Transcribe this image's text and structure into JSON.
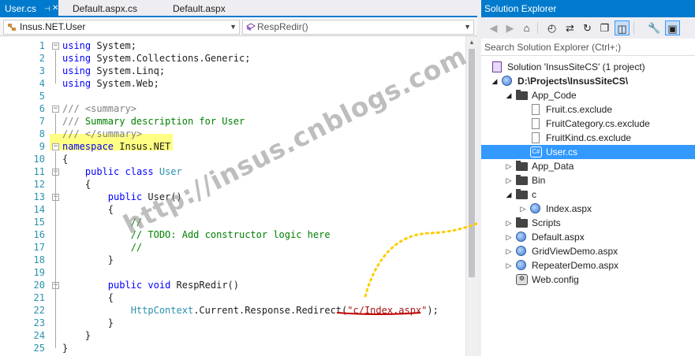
{
  "editor": {
    "tabs": [
      {
        "label": "User.cs",
        "active": true
      },
      {
        "label": "Default.aspx.cs",
        "active": false
      },
      {
        "label": "Default.aspx",
        "active": false
      }
    ],
    "pin_icon": "pin-icon",
    "close_icon": "close-icon",
    "nav_class": "Insus.NET.User",
    "nav_member": "RespRedir()",
    "lines": [
      {
        "n": "1",
        "segs": [
          {
            "c": "kw",
            "t": "using"
          },
          {
            "c": "",
            "t": " System;"
          }
        ],
        "fold": "minus"
      },
      {
        "n": "2",
        "segs": [
          {
            "c": "kw",
            "t": "using"
          },
          {
            "c": "",
            "t": " System.Collections.Generic;"
          }
        ]
      },
      {
        "n": "3",
        "segs": [
          {
            "c": "kw",
            "t": "using"
          },
          {
            "c": "",
            "t": " System.Linq;"
          }
        ]
      },
      {
        "n": "4",
        "segs": [
          {
            "c": "kw",
            "t": "using"
          },
          {
            "c": "",
            "t": " System.Web;"
          }
        ]
      },
      {
        "n": "5",
        "segs": []
      },
      {
        "n": "6",
        "segs": [
          {
            "c": "dc",
            "t": "/// "
          },
          {
            "c": "dc",
            "t": "<summary>"
          }
        ],
        "fold": "minus"
      },
      {
        "n": "7",
        "segs": [
          {
            "c": "dc",
            "t": "/// "
          },
          {
            "c": "cm",
            "t": "Summary description for User"
          }
        ]
      },
      {
        "n": "8",
        "segs": [
          {
            "c": "dc",
            "t": "/// </summary>"
          }
        ]
      },
      {
        "n": "9",
        "segs": [
          {
            "c": "kw",
            "t": "namespace"
          },
          {
            "c": "",
            "t": " Insus.NET"
          }
        ],
        "fold": "minus"
      },
      {
        "n": "10",
        "segs": [
          {
            "c": "",
            "t": "{"
          }
        ]
      },
      {
        "n": "11",
        "segs": [
          {
            "c": "",
            "t": "    "
          },
          {
            "c": "kw",
            "t": "public"
          },
          {
            "c": "",
            "t": " "
          },
          {
            "c": "kw",
            "t": "class"
          },
          {
            "c": "",
            "t": " "
          },
          {
            "c": "ty",
            "t": "User"
          }
        ],
        "fold": "minus"
      },
      {
        "n": "12",
        "segs": [
          {
            "c": "",
            "t": "    {"
          }
        ]
      },
      {
        "n": "13",
        "segs": [
          {
            "c": "",
            "t": "        "
          },
          {
            "c": "kw",
            "t": "public"
          },
          {
            "c": "",
            "t": " User()"
          }
        ],
        "fold": "minus"
      },
      {
        "n": "14",
        "segs": [
          {
            "c": "",
            "t": "        {"
          }
        ]
      },
      {
        "n": "15",
        "segs": [
          {
            "c": "",
            "t": "            "
          },
          {
            "c": "cm",
            "t": "//"
          }
        ]
      },
      {
        "n": "16",
        "segs": [
          {
            "c": "",
            "t": "            "
          },
          {
            "c": "cm",
            "t": "// TODO: Add constructor logic here"
          }
        ]
      },
      {
        "n": "17",
        "segs": [
          {
            "c": "",
            "t": "            "
          },
          {
            "c": "cm",
            "t": "//"
          }
        ]
      },
      {
        "n": "18",
        "segs": [
          {
            "c": "",
            "t": "        }"
          }
        ]
      },
      {
        "n": "19",
        "segs": []
      },
      {
        "n": "20",
        "segs": [
          {
            "c": "",
            "t": "        "
          },
          {
            "c": "kw",
            "t": "public"
          },
          {
            "c": "",
            "t": " "
          },
          {
            "c": "kw",
            "t": "void"
          },
          {
            "c": "",
            "t": " RespRedir()"
          }
        ],
        "fold": "minus"
      },
      {
        "n": "21",
        "segs": [
          {
            "c": "",
            "t": "        {"
          }
        ]
      },
      {
        "n": "22",
        "segs": [
          {
            "c": "",
            "t": "            "
          },
          {
            "c": "ty",
            "t": "HttpContext"
          },
          {
            "c": "",
            "t": ".Current.Response.Redirect("
          },
          {
            "c": "st",
            "t": "\"c/Index.aspx\""
          },
          {
            "c": "",
            "t": ");"
          }
        ]
      },
      {
        "n": "23",
        "segs": [
          {
            "c": "",
            "t": "        }"
          }
        ]
      },
      {
        "n": "24",
        "segs": [
          {
            "c": "",
            "t": "    }"
          }
        ]
      },
      {
        "n": "25",
        "segs": [
          {
            "c": "",
            "t": "}"
          }
        ]
      }
    ],
    "watermark": "http://insus.cnblogs.com",
    "colors": {
      "highlight": "#ffff00",
      "underline": "#c00000",
      "arrow": "#ffcc00",
      "accent": "#007acc"
    }
  },
  "solution_explorer": {
    "title": "Solution Explorer",
    "search_placeholder": "Search Solution Explorer (Ctrl+;)",
    "toolbar_icons": [
      "back-icon",
      "forward-icon",
      "home-icon",
      "history-icon",
      "sync-icon",
      "refresh-icon",
      "collapse-all-icon",
      "show-all-files-icon",
      "properties-icon",
      "preview-icon"
    ],
    "tree": [
      {
        "label": "Solution 'InsusSiteCS' (1 project)",
        "depth": 0,
        "icon": "solution",
        "exp": ""
      },
      {
        "label": "D:\\Projects\\InsusSiteCS\\",
        "depth": 0,
        "icon": "globe",
        "exp": "open",
        "bold": true
      },
      {
        "label": "App_Code",
        "depth": 1,
        "icon": "folder",
        "exp": "open"
      },
      {
        "label": "Fruit.cs.exclude",
        "depth": 2,
        "icon": "file",
        "exp": ""
      },
      {
        "label": "FruitCategory.cs.exclude",
        "depth": 2,
        "icon": "file",
        "exp": ""
      },
      {
        "label": "FruitKind.cs.exclude",
        "depth": 2,
        "icon": "file",
        "exp": ""
      },
      {
        "label": "User.cs",
        "depth": 2,
        "icon": "cs",
        "exp": "",
        "selected": true
      },
      {
        "label": "App_Data",
        "depth": 1,
        "icon": "folder",
        "exp": "closed"
      },
      {
        "label": "Bin",
        "depth": 1,
        "icon": "folder",
        "exp": "closed"
      },
      {
        "label": "c",
        "depth": 1,
        "icon": "folder",
        "exp": "open"
      },
      {
        "label": "Index.aspx",
        "depth": 2,
        "icon": "globe",
        "exp": "closed"
      },
      {
        "label": "Scripts",
        "depth": 1,
        "icon": "folder",
        "exp": "closed"
      },
      {
        "label": "Default.aspx",
        "depth": 1,
        "icon": "globe",
        "exp": "closed"
      },
      {
        "label": "GridViewDemo.aspx",
        "depth": 1,
        "icon": "globe",
        "exp": "closed"
      },
      {
        "label": "RepeaterDemo.aspx",
        "depth": 1,
        "icon": "globe",
        "exp": "closed"
      },
      {
        "label": "Web.config",
        "depth": 1,
        "icon": "gear",
        "exp": ""
      }
    ]
  }
}
